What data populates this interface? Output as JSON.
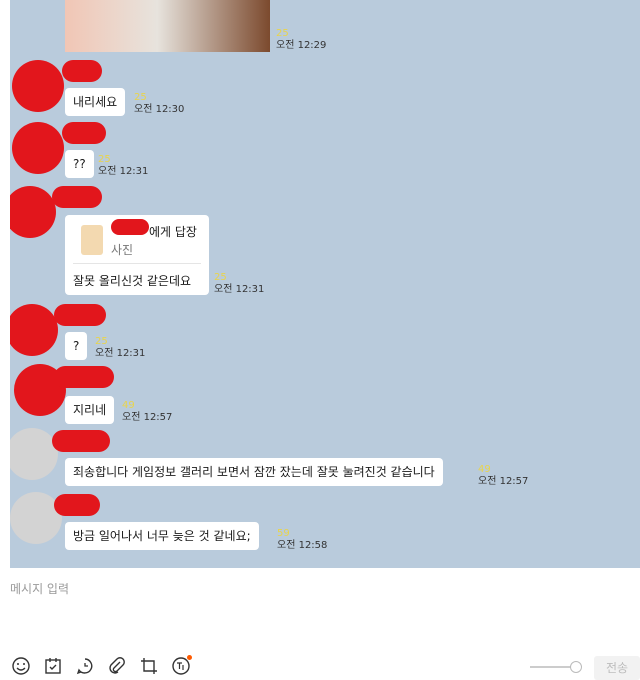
{
  "messages": [
    {
      "text": "내리세요",
      "count": "25",
      "time": "오전 12:30"
    },
    {
      "text": "??",
      "count": "25",
      "time": "오전 12:31"
    },
    {
      "reply_to_suffix": "에게 답장",
      "reply_kind": "사진",
      "text": "잘못 올리신것 같은데요",
      "count": "25",
      "time": "오전 12:31"
    },
    {
      "text": "?",
      "count": "25",
      "time": "오전 12:31"
    },
    {
      "text": "지리네",
      "count": "49",
      "time": "오전 12:57"
    },
    {
      "text": "죄송합니다 게임정보 갤러리 보면서 잠깐 잤는데 잘못 눌려진것 같습니다",
      "count": "49",
      "time": "오전 12:57"
    },
    {
      "text": "방금 일어나서 너무 늦은 것 같네요;",
      "count": "59",
      "time": "오전 12:58"
    }
  ],
  "photo_msg": {
    "count": "25",
    "time": "오전 12:29"
  },
  "input": {
    "placeholder": "메시지 입력"
  },
  "send_label": "전송",
  "colors": {
    "chat_bg": "#b9cbdc",
    "redaction": "#e2161c",
    "read_count": "#e8d44d"
  },
  "toolbar_icons": [
    "emoji-icon",
    "calendar-icon",
    "chat-bubble-icon",
    "paperclip-icon",
    "crop-icon",
    "translate-icon"
  ]
}
